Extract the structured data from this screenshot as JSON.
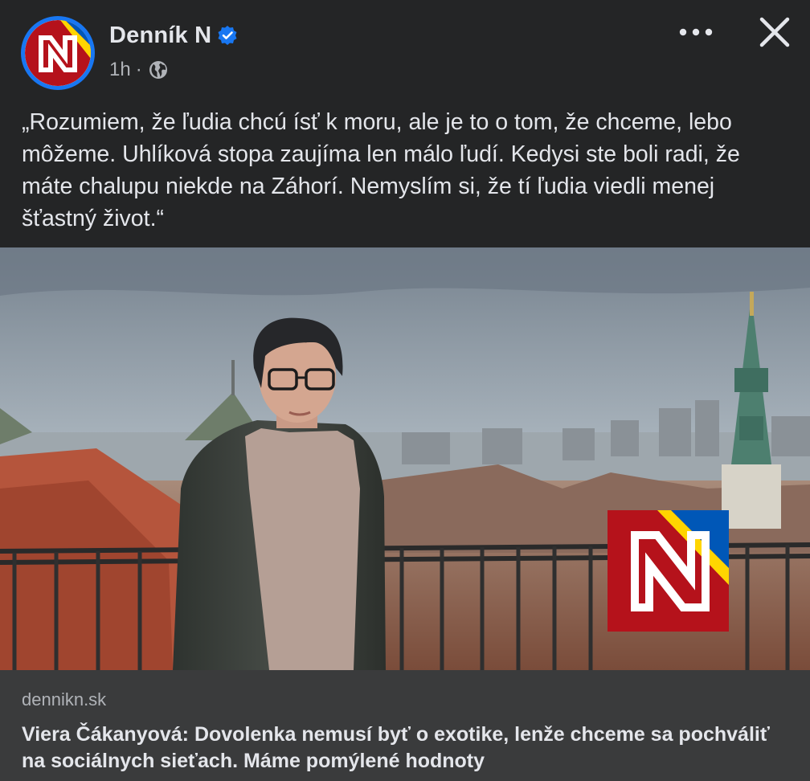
{
  "header": {
    "page_name": "Denník N",
    "timestamp": "1h",
    "separator": "·",
    "audience_icon": "globe-icon",
    "verified_icon": "verified-badge-icon",
    "more_icon": "more-options-icon",
    "close_icon": "close-icon"
  },
  "post": {
    "text": "„Rozumiem, že ľudia chcú ísť k moru, ale je to o tom, že chceme, lebo môžeme. Uhlíková stopa zaujíma len málo ľudí. Kedysi ste boli radi, že máte chalupu niekde na Záhorí. Nemyslím si, že tí ľudia viedli menej šťastný život.“"
  },
  "link_preview": {
    "domain": "dennikn.sk",
    "headline": "Viera Čákanyová: Dovolenka nemusí byť o exotike, lenže chceme sa pochváliť na sociálnych sieťach. Máme pomýlené hodnoty"
  },
  "colors": {
    "background": "#242526",
    "link_card": "#3a3b3c",
    "verified_blue": "#1877f2",
    "logo_red": "#b5121b",
    "logo_yellow": "#ffd500",
    "logo_blue": "#0057b7"
  }
}
